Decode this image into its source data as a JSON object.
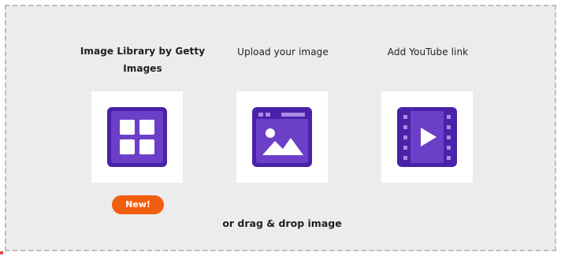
{
  "options": {
    "getty": {
      "label": "Image Library by Getty Images",
      "icon": "grid-icon",
      "badge": "New!"
    },
    "upload": {
      "label": "Upload your image",
      "icon": "image-upload-icon"
    },
    "youtube": {
      "label": "Add YouTube link",
      "icon": "video-play-icon"
    }
  },
  "drag_drop_text": "or drag & drop image",
  "colors": {
    "accent_purple": "#4a22a8",
    "icon_fill": "#6b3fc7",
    "badge_orange": "#f25e10",
    "dropzone_bg": "#ececec"
  }
}
